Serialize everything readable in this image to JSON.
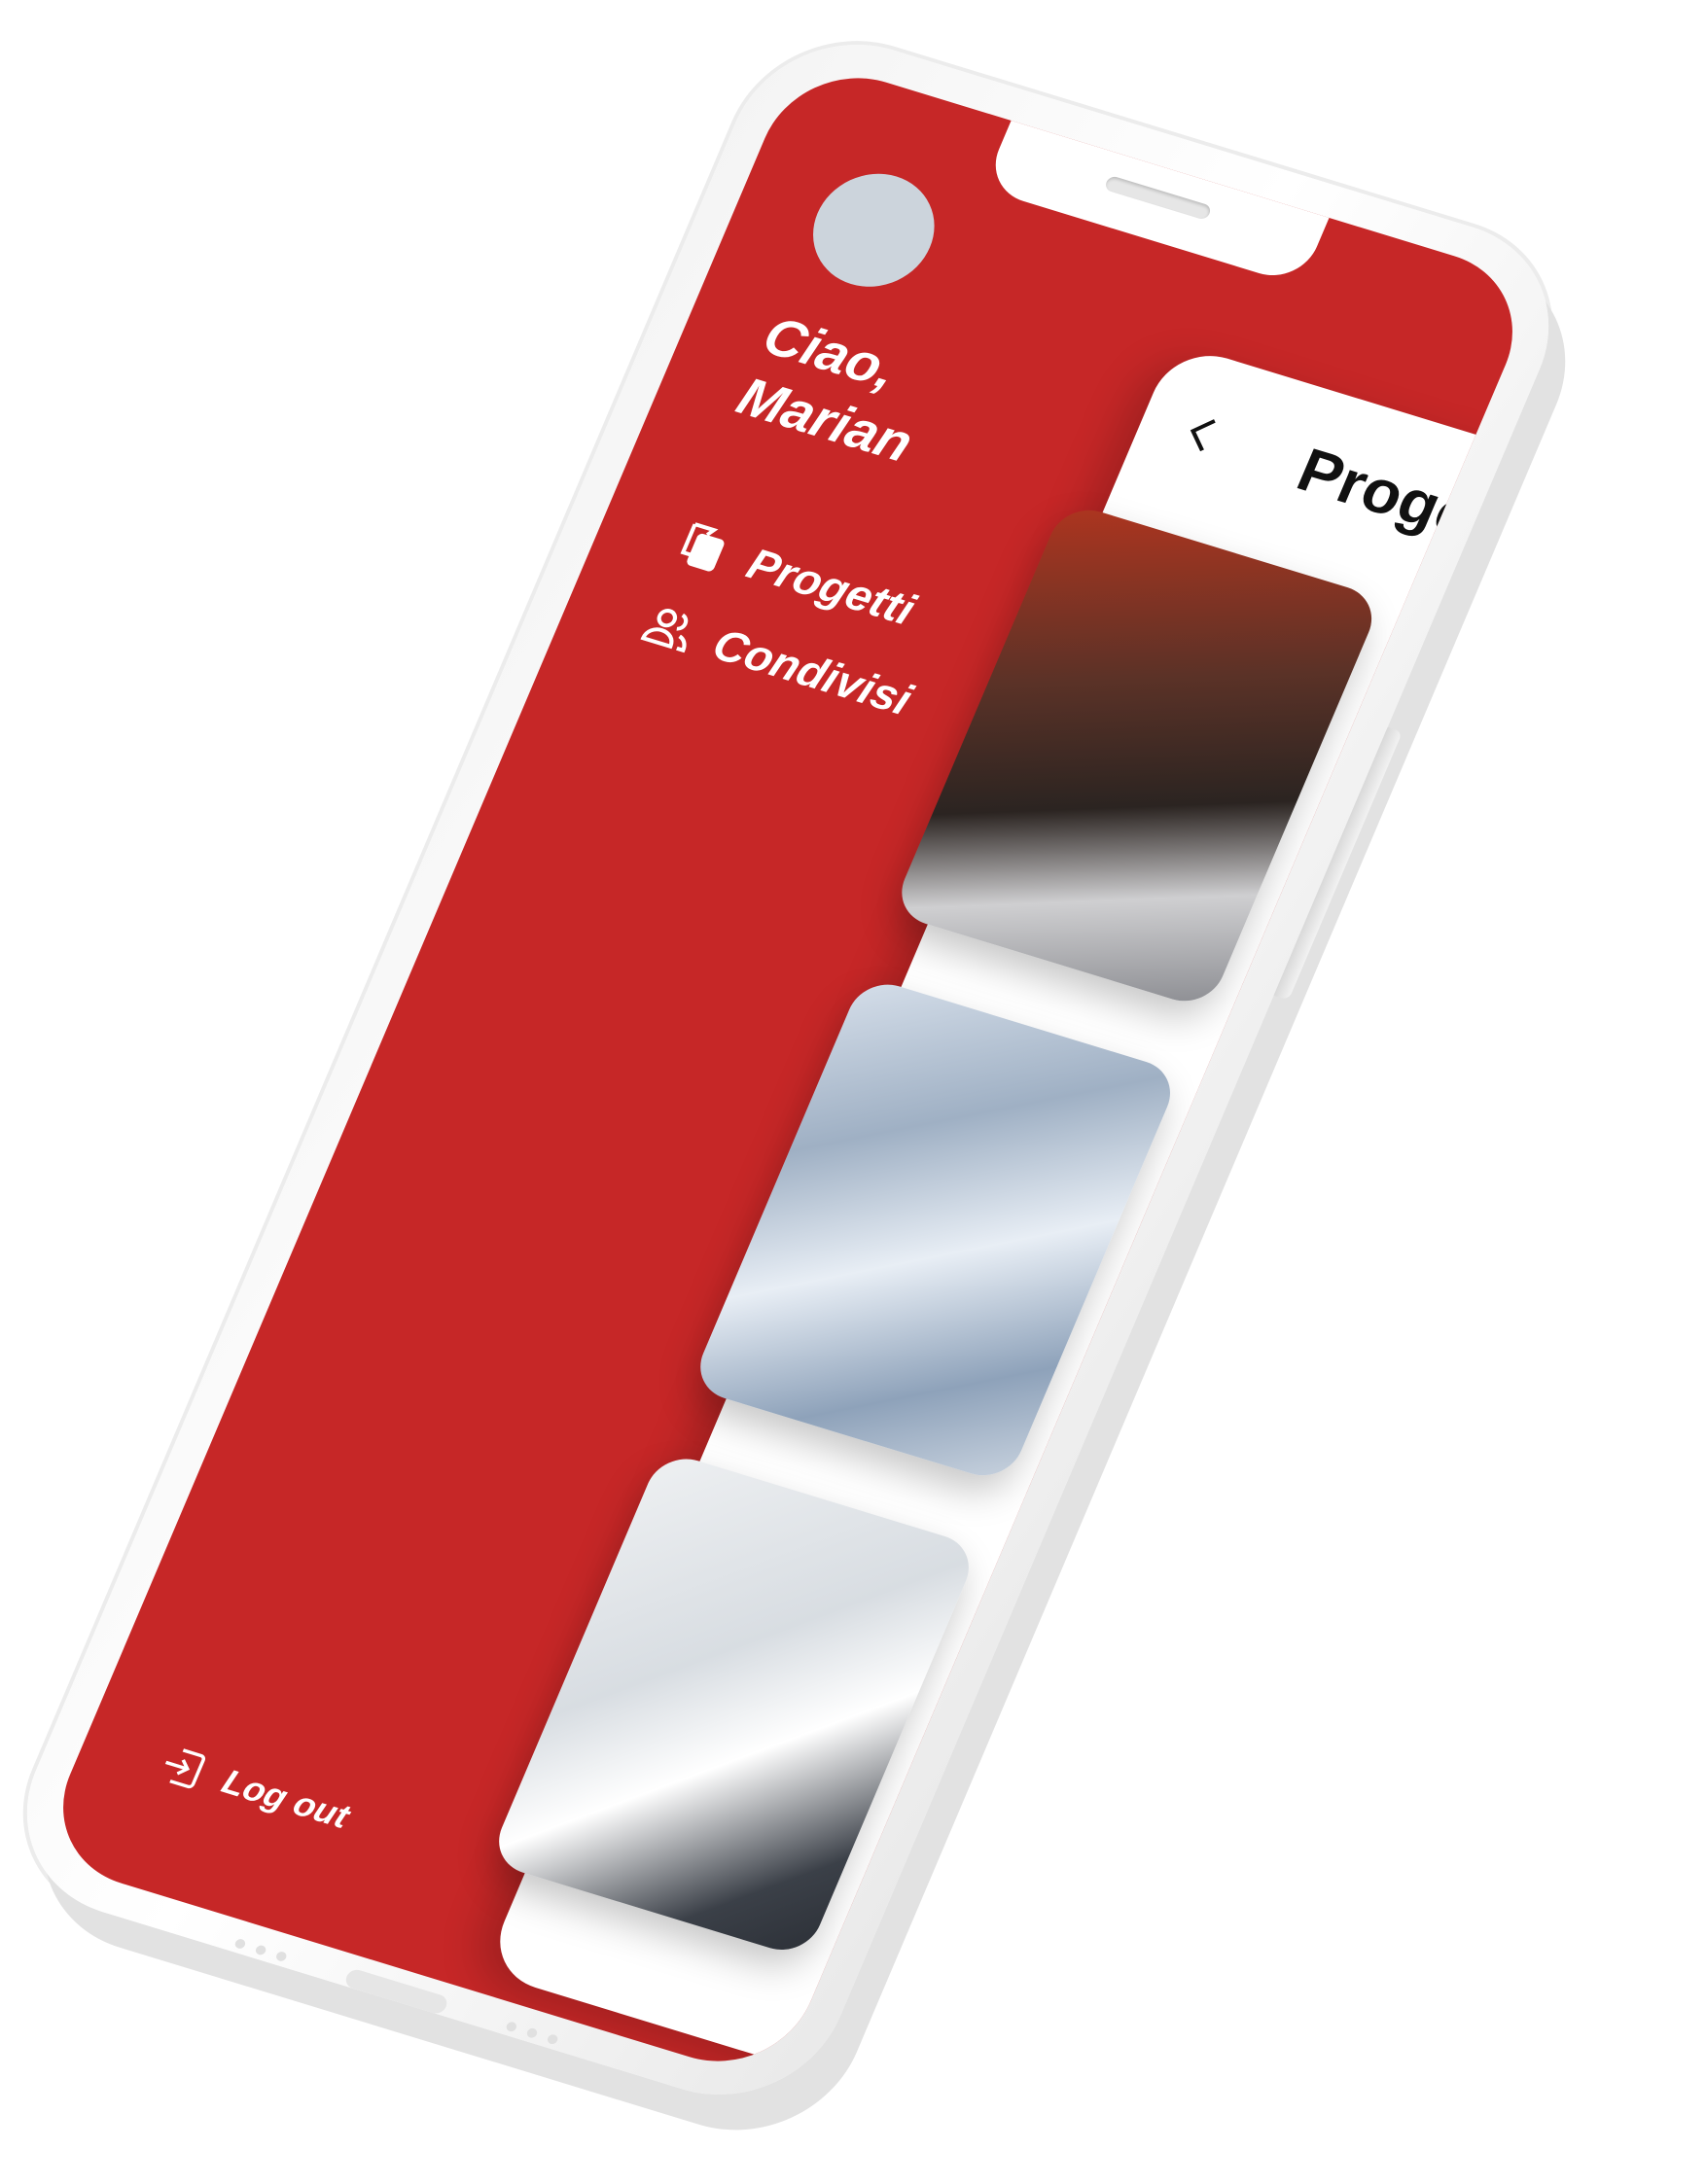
{
  "drawer": {
    "greeting_line1": "Ciao,",
    "greeting_line2": "Marian",
    "menu": [
      {
        "label": "Progetti",
        "icon": "documents-icon"
      },
      {
        "label": "Condivisi",
        "icon": "users-icon"
      }
    ],
    "logout_label": "Log out",
    "logout_icon": "logout-icon"
  },
  "panel": {
    "title": "Proge",
    "back_icon": "chevron-left-icon"
  },
  "colors": {
    "accent": "#c62727",
    "avatar": "#ccd4dc",
    "panel": "#ffffff"
  }
}
